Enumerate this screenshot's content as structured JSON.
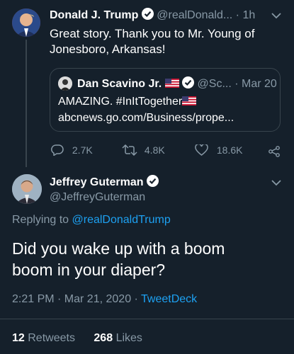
{
  "tweet1": {
    "name": "Donald J. Trump",
    "handle": "@realDonald...",
    "time": "· 1h",
    "text_line1": "Great story. Thank you to Mr. Young of",
    "text_line2": "Jonesboro, Arkansas!",
    "quote": {
      "name": "Dan Scavino Jr.",
      "handle": "@Sc...",
      "time": "· Mar 20",
      "text": "AMAZING. #InItTogether",
      "link": "abcnews.go.com/Business/prope..."
    },
    "replies": "2.7K",
    "retweets": "4.8K",
    "likes": "18.6K"
  },
  "tweet2": {
    "name": "Jeffrey Guterman",
    "handle": "@JeffreyGuterman",
    "replying_prefix": "Replying to",
    "replying_to": "@realDonaldTrump",
    "text_line1": "Did you wake up with a boom",
    "text_line2": "boom in your diaper?",
    "timestamp": "2:21 PM · Mar 21, 2020 ·",
    "source": "TweetDeck",
    "retweet_count": "12",
    "retweet_label": "Retweets",
    "like_count": "268",
    "like_label": "Likes"
  },
  "colors": {
    "background": "#15202b",
    "muted": "#8899a6",
    "accent": "#1da1f2",
    "border": "#38444d"
  }
}
